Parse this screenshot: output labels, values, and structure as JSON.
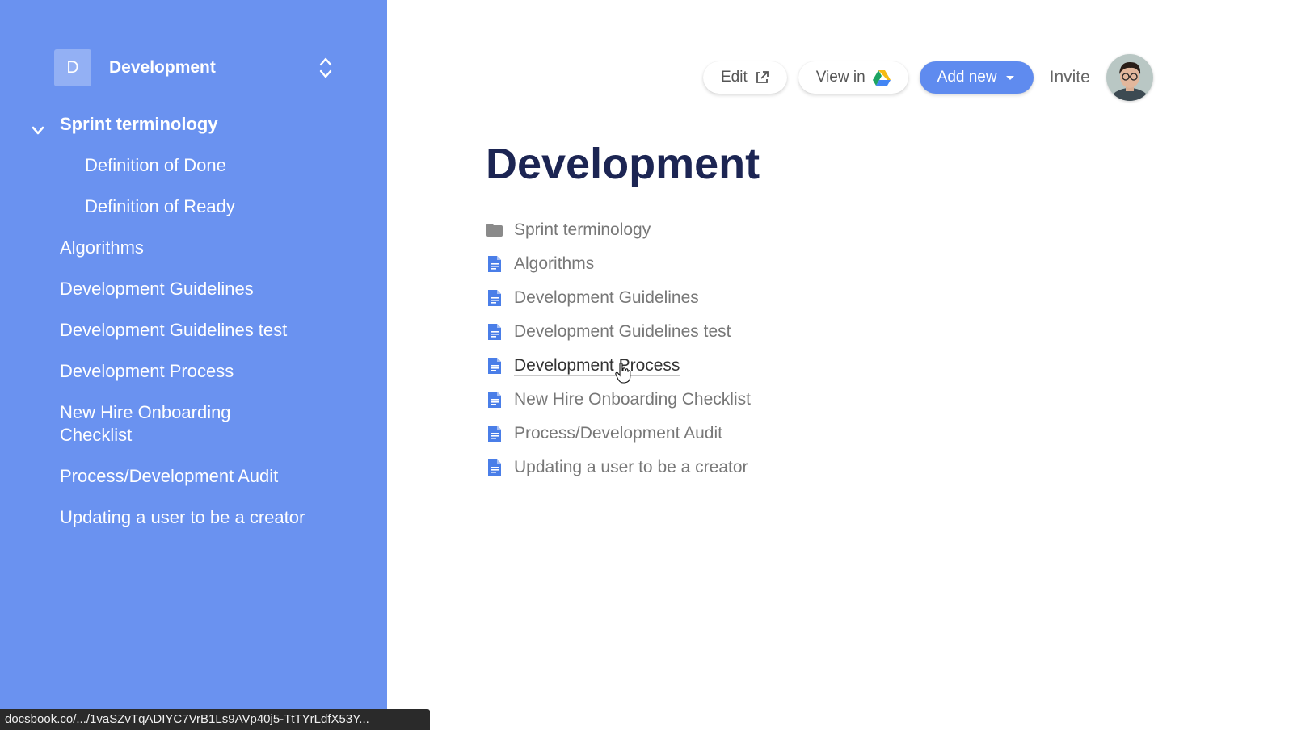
{
  "workspace": {
    "badge": "D",
    "name": "Development"
  },
  "sidebar": {
    "items": [
      {
        "label": "Sprint terminology",
        "type": "folder",
        "expanded": true
      },
      {
        "label": "Definition of Done",
        "type": "child"
      },
      {
        "label": "Definition of Ready",
        "type": "child"
      },
      {
        "label": "Algorithms",
        "type": "doc"
      },
      {
        "label": "Development Guidelines",
        "type": "doc"
      },
      {
        "label": "Development Guidelines test",
        "type": "doc"
      },
      {
        "label": "Development Process",
        "type": "doc"
      },
      {
        "label": "New Hire Onboarding Checklist",
        "type": "doc"
      },
      {
        "label": "Process/Development Audit",
        "type": "doc"
      },
      {
        "label": "Updating a user to be a creator",
        "type": "doc"
      }
    ]
  },
  "toolbar": {
    "edit_label": "Edit",
    "view_label": "View in",
    "add_label": "Add new",
    "invite_label": "Invite"
  },
  "main": {
    "title": "Development",
    "docs": [
      {
        "label": "Sprint terminology",
        "icon": "folder-icon"
      },
      {
        "label": "Algorithms",
        "icon": "doc-icon"
      },
      {
        "label": "Development Guidelines",
        "icon": "doc-icon"
      },
      {
        "label": "Development Guidelines test",
        "icon": "doc-icon"
      },
      {
        "label": "Development Process",
        "icon": "doc-icon",
        "hovered": true
      },
      {
        "label": "New Hire Onboarding Checklist",
        "icon": "doc-icon"
      },
      {
        "label": "Process/Development Audit",
        "icon": "doc-icon"
      },
      {
        "label": "Updating a user to be a creator",
        "icon": "doc-icon"
      }
    ]
  },
  "status_bar": {
    "url": "docsbook.co/.../1vaSZvTqADIYC7VrB1Ls9AVp40j5-TtTYrLdfX53Y..."
  },
  "colors": {
    "sidebar_bg": "#6a92f0",
    "primary": "#5f8bef",
    "title": "#1c2553",
    "doc_icon": "#4a7ee8"
  }
}
